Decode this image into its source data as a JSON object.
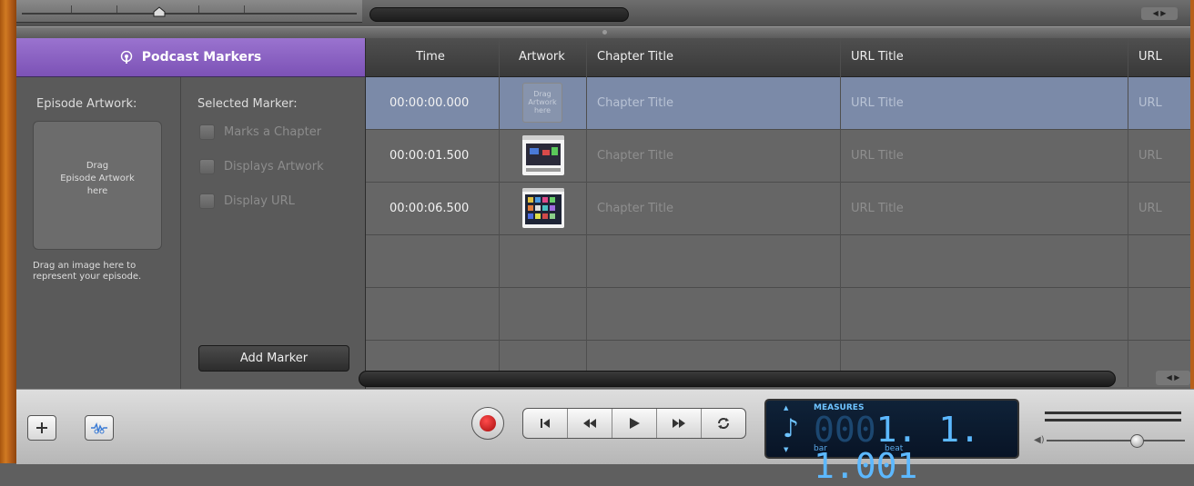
{
  "podcast_panel": {
    "title": "Podcast Markers",
    "episode_artwork_label": "Episode Artwork:",
    "drop_text": "Drag\nEpisode Artwork\nhere",
    "hint": "Drag an image here to represent your episode.",
    "selected_marker_label": "Selected Marker:",
    "options": [
      "Marks a Chapter",
      "Displays Artwork",
      "Display URL"
    ],
    "add_marker": "Add Marker"
  },
  "table": {
    "headers": {
      "time": "Time",
      "artwork": "Artwork",
      "chapter": "Chapter Title",
      "url_title": "URL Title",
      "url": "URL"
    },
    "rows": [
      {
        "time": "00:00:00.000",
        "artwork": "Drag\nArtwork\nhere",
        "chapter": "Chapter Title",
        "url_title": "URL Title",
        "url": "URL",
        "selected": true
      },
      {
        "time": "00:00:01.500",
        "artwork": "",
        "chapter": "Chapter Title",
        "url_title": "URL Title",
        "url": "URL",
        "selected": false
      },
      {
        "time": "00:00:06.500",
        "artwork": "",
        "chapter": "Chapter Title",
        "url_title": "URL Title",
        "url": "URL",
        "selected": false
      }
    ]
  },
  "lcd": {
    "mode": "MEASURES",
    "ghost": "000",
    "value": "1.  1.  1.001",
    "bar_label": "bar",
    "beat_label": "beat"
  },
  "colors": {
    "accent_purple": "#8a62c3",
    "selected_row": "#7b8aa8",
    "lcd_blue": "#5cb8ff"
  }
}
